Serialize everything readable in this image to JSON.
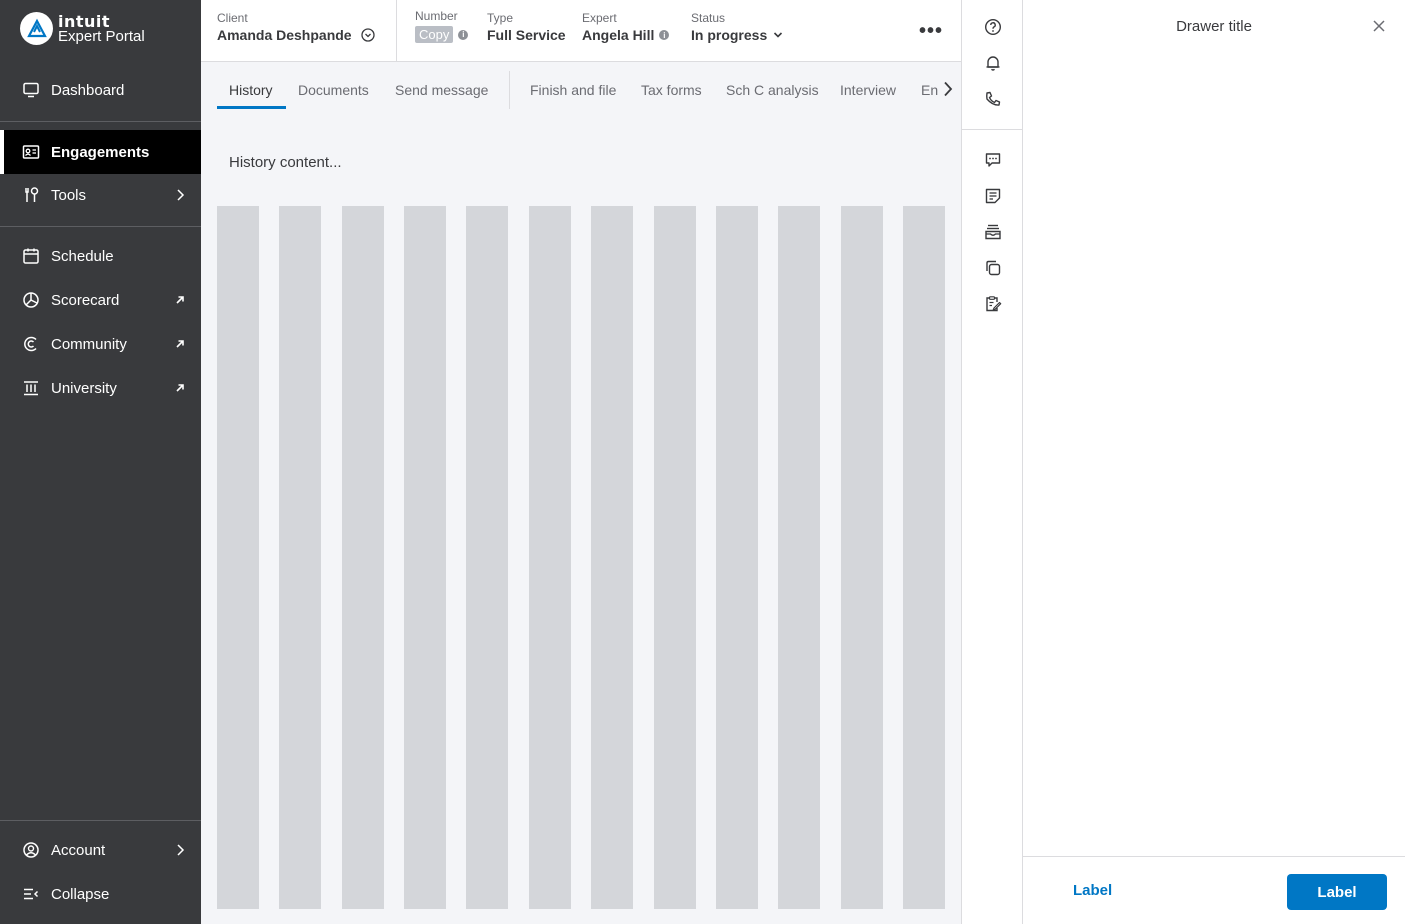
{
  "brand": {
    "name": "intuit",
    "product": "Expert Portal"
  },
  "sidebar": {
    "items": [
      {
        "label": "Dashboard",
        "icon": "monitor-icon"
      },
      {
        "label": "Engagements",
        "icon": "id-card-icon",
        "active": true
      },
      {
        "label": "Tools",
        "icon": "tools-icon",
        "trailing": "chevron-right-icon"
      },
      {
        "label": "Schedule",
        "icon": "calendar-icon"
      },
      {
        "label": "Scorecard",
        "icon": "pie-chart-icon",
        "trailing": "external-link-icon"
      },
      {
        "label": "Community",
        "icon": "community-icon",
        "trailing": "external-link-icon"
      },
      {
        "label": "University",
        "icon": "university-icon",
        "trailing": "external-link-icon"
      }
    ],
    "footer": [
      {
        "label": "Account",
        "icon": "account-icon",
        "trailing": "chevron-right-icon"
      },
      {
        "label": "Collapse",
        "icon": "collapse-icon"
      }
    ]
  },
  "header": {
    "client": {
      "label": "Client",
      "value": "Amanda Deshpande"
    },
    "number": {
      "label": "Number",
      "copy_label": "Copy"
    },
    "type": {
      "label": "Type",
      "value": "Full Service"
    },
    "expert": {
      "label": "Expert",
      "value": "Angela Hill"
    },
    "status": {
      "label": "Status",
      "value": "In progress"
    },
    "more_label": "•••"
  },
  "tabs": [
    {
      "label": "History",
      "active": true
    },
    {
      "label": "Documents"
    },
    {
      "label": "Send message"
    },
    {
      "label": "Finish and file"
    },
    {
      "label": "Tax forms"
    },
    {
      "label": "Sch C analysis"
    },
    {
      "label": "Interview"
    },
    {
      "label": "En"
    }
  ],
  "main": {
    "history_text": "History content..."
  },
  "rail": {
    "top_icons": [
      "help-icon",
      "bell-icon",
      "phone-icon"
    ],
    "bottom_icons": [
      "chat-icon",
      "notes-icon",
      "inbox-icon",
      "copy-docs-icon",
      "edit-checklist-icon"
    ]
  },
  "drawer": {
    "title": "Drawer title",
    "secondary_label": "Label",
    "primary_label": "Label"
  },
  "colors": {
    "sidebar_bg": "#393a3d",
    "accent": "#0077c5",
    "placeholder": "#d4d6da"
  }
}
